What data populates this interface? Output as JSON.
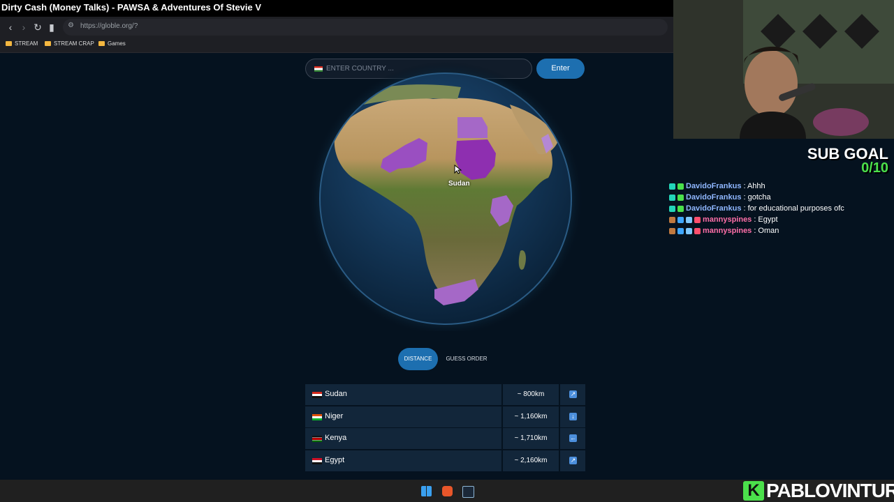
{
  "stream": {
    "now_playing": "Dirty Cash (Money Talks) - PAWSA & Adventures Of Stevie V"
  },
  "browser": {
    "url": "https://globle.org/?",
    "bookmarks": [
      {
        "label": "STREAM"
      },
      {
        "label": "STREAM CRAP"
      },
      {
        "label": "Games"
      }
    ]
  },
  "game": {
    "search_placeholder": "ENTER COUNTRY ...",
    "enter_label": "Enter",
    "hover_country": "Sudan",
    "sort_distance": "DISTANCE",
    "sort_order": "GUESS ORDER",
    "guesses": [
      {
        "name": "Sudan",
        "distance": "~ 800km",
        "direction": "↗"
      },
      {
        "name": "Niger",
        "distance": "~ 1,160km",
        "direction": "↓"
      },
      {
        "name": "Kenya",
        "distance": "~ 1,710km",
        "direction": "←"
      },
      {
        "name": "Egypt",
        "distance": "~ 2,160km",
        "direction": "↗"
      }
    ]
  },
  "overlay": {
    "sub_goal_title": "SUB GOAL",
    "sub_goal_count": "0/10",
    "chat": [
      {
        "user": "DavidoFrankus",
        "message": ": Ahhh",
        "color": "#8fb7ff"
      },
      {
        "user": "DavidoFrankus",
        "message": ": gotcha",
        "color": "#8fb7ff"
      },
      {
        "user": "DavidoFrankus",
        "message": ": for educational purposes ofc",
        "color": "#8fb7ff"
      },
      {
        "user": "mannyspines",
        "message": ": Egypt",
        "color": "#ff6fa8"
      },
      {
        "user": "mannyspines",
        "message": ": Oman",
        "color": "#ff6fa8"
      }
    ],
    "brand": "PABLOVINTURA"
  }
}
